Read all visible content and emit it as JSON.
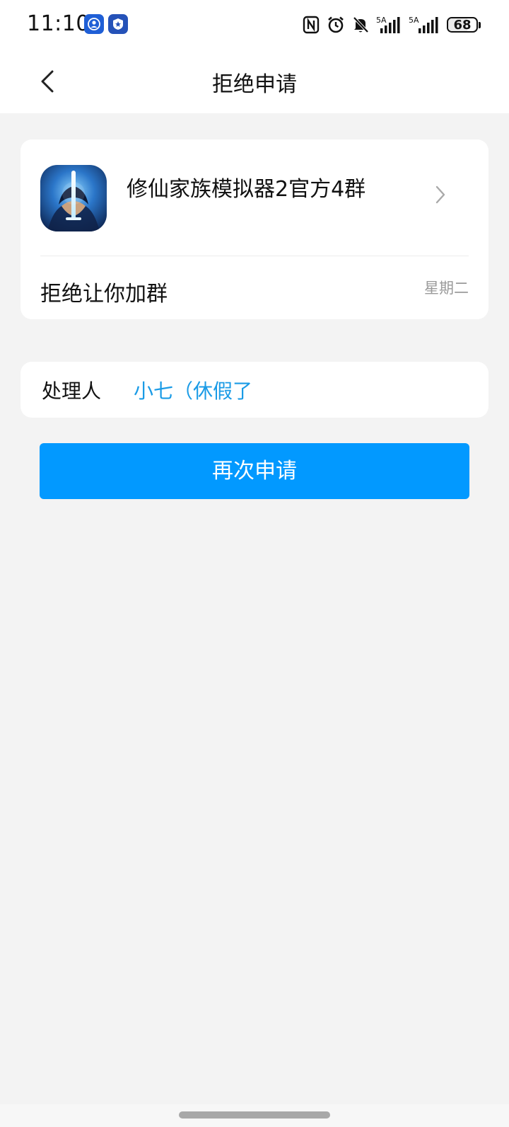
{
  "status_bar": {
    "time": "11:10",
    "network_1_label": "5A",
    "network_2_label": "5A",
    "battery_level": "68",
    "icons": [
      "shield-app-icon",
      "badge-app-icon",
      "nfc-icon",
      "alarm-icon",
      "mute-bell-icon",
      "signal-icon",
      "signal-icon",
      "battery-icon"
    ]
  },
  "nav": {
    "title": "拒绝申请",
    "back_icon": "chevron-left-icon"
  },
  "group": {
    "name": "修仙家族模拟器2官方4群",
    "status_text": "拒绝让你加群",
    "time": "星期二",
    "chevron_icon": "chevron-right-icon"
  },
  "handler": {
    "label": "处理人",
    "value": "小七（休假了"
  },
  "actions": {
    "reapply_label": "再次申请"
  },
  "colors": {
    "accent": "#0299ff",
    "link": "#1a9be6",
    "background": "#f3f3f3",
    "secondary_text": "#9a9a9a"
  }
}
